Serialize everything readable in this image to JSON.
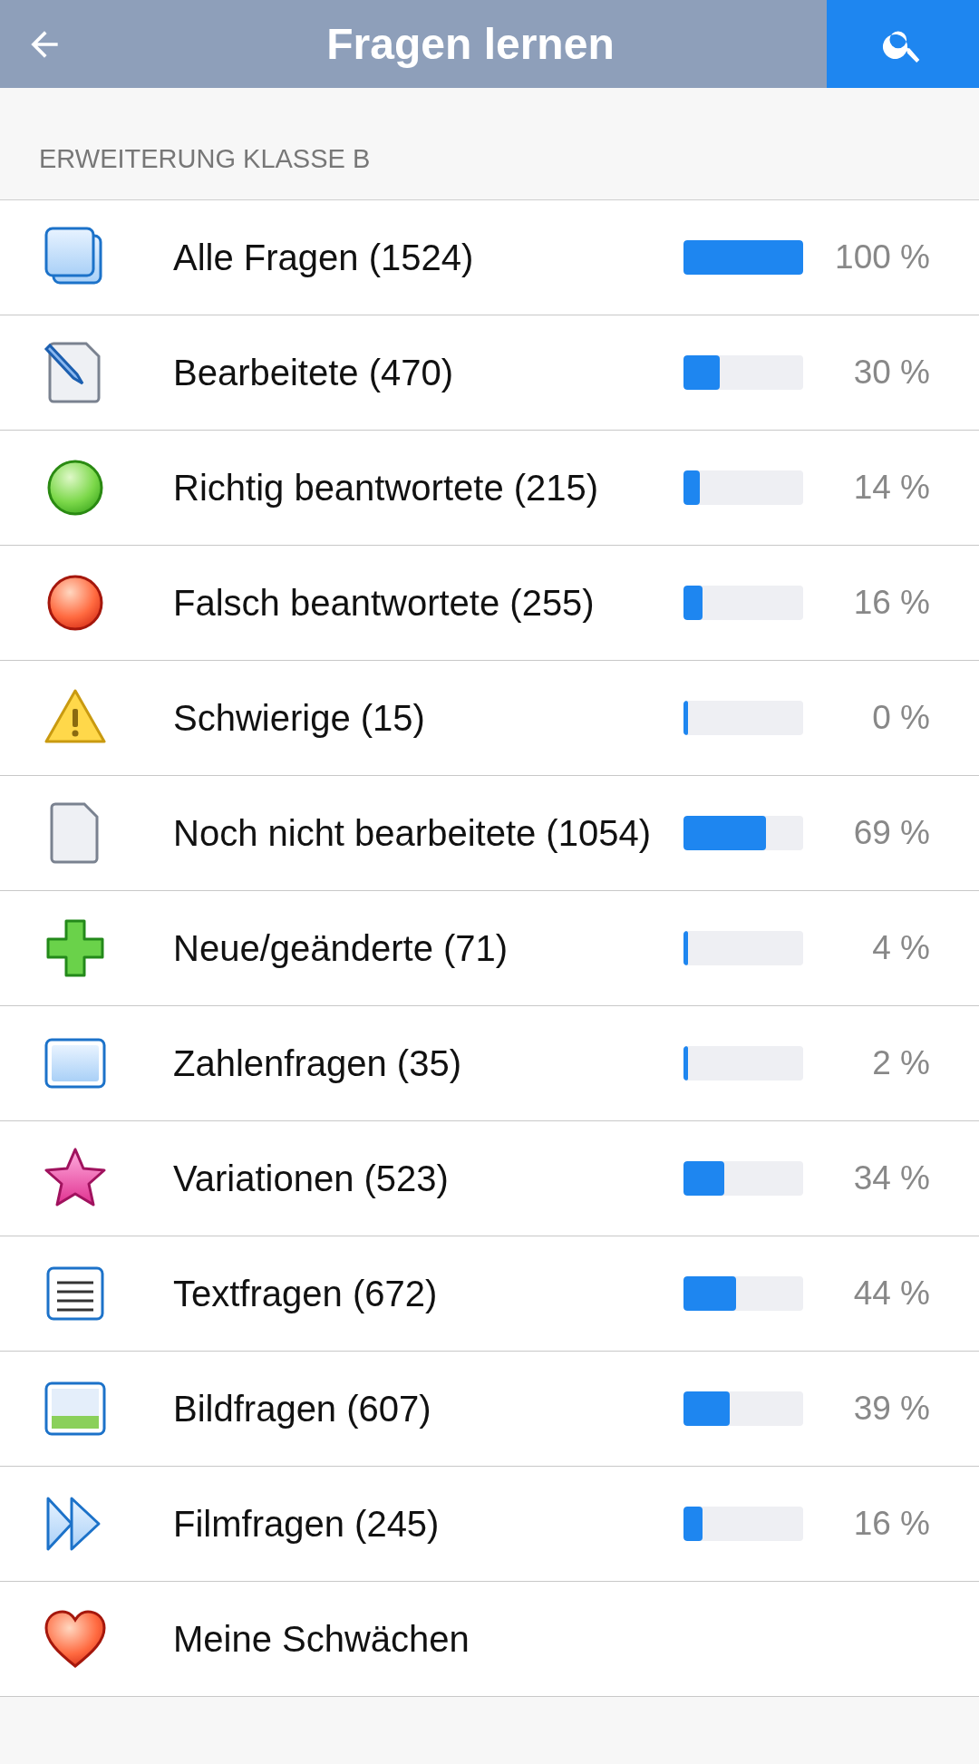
{
  "header": {
    "title": "Fragen lernen"
  },
  "section": {
    "title": "ERWEITERUNG KLASSE B"
  },
  "items": [
    {
      "kind": "all",
      "label": "Alle Fragen (1524)",
      "level": 1,
      "percent": "100 %"
    },
    {
      "kind": "edited",
      "label": "Bearbeitete (470)",
      "level": 0.3,
      "percent": "30 %"
    },
    {
      "kind": "correct",
      "label": "Richtig beantwortete (215)",
      "level": 0.14,
      "percent": "14 %"
    },
    {
      "kind": "wrong",
      "label": "Falsch beantwortete (255)",
      "level": 0.16,
      "percent": "16 %"
    },
    {
      "kind": "difficult",
      "label": "Schwierige (15)",
      "level": 0,
      "percent": "0 %"
    },
    {
      "kind": "unedited",
      "label": "Noch nicht bearbeitete (1054)",
      "level": 0.69,
      "percent": "69 %"
    },
    {
      "kind": "new",
      "label": "Neue/geänderte (71)",
      "level": 0.04,
      "percent": "4 %"
    },
    {
      "kind": "number",
      "label": "Zahlenfragen (35)",
      "level": 0.02,
      "percent": "2 %"
    },
    {
      "kind": "variation",
      "label": "Variationen (523)",
      "level": 0.34,
      "percent": "34 %"
    },
    {
      "kind": "text",
      "label": "Textfragen (672)",
      "level": 0.44,
      "percent": "44 %"
    },
    {
      "kind": "image",
      "label": "Bildfragen (607)",
      "level": 0.39,
      "percent": "39 %"
    },
    {
      "kind": "film",
      "label": "Filmfragen (245)",
      "level": 0.16,
      "percent": "16 %"
    },
    {
      "kind": "weakness",
      "label": "Meine Schwächen"
    }
  ]
}
